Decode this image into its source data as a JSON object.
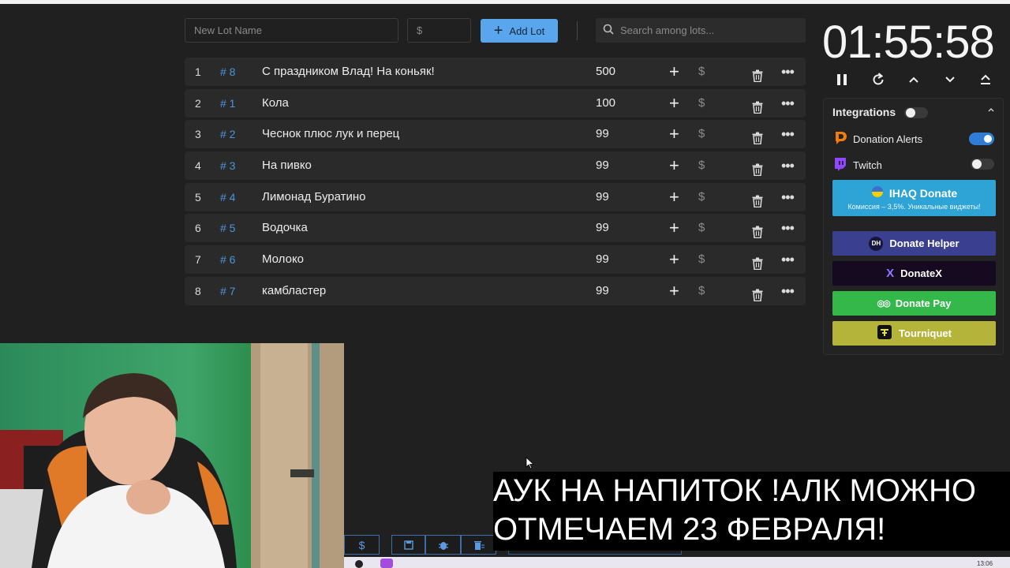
{
  "toolbar": {
    "lot_name_placeholder": "New Lot Name",
    "amount_placeholder": "$",
    "add_button_label": "Add Lot",
    "search_placeholder": "Search among lots..."
  },
  "lots": [
    {
      "index": "1",
      "id": "# 8",
      "name": "С праздником Влад! На коньяк!",
      "amount": "500"
    },
    {
      "index": "2",
      "id": "# 1",
      "name": "Кола",
      "amount": "100"
    },
    {
      "index": "3",
      "id": "# 2",
      "name": "Чеснок плюс лук и перец",
      "amount": "99"
    },
    {
      "index": "4",
      "id": "# 3",
      "name": "На пивко",
      "amount": "99"
    },
    {
      "index": "5",
      "id": "# 4",
      "name": "Лимонад Буратино",
      "amount": "99"
    },
    {
      "index": "6",
      "id": "# 5",
      "name": "Водочка",
      "amount": "99"
    },
    {
      "index": "7",
      "id": "# 6",
      "name": "Молоко",
      "amount": "99"
    },
    {
      "index": "8",
      "id": "# 7",
      "name": "камбластер",
      "amount": "99"
    }
  ],
  "lot_actions": {
    "plus": "+",
    "dollar": "$",
    "more": "•••"
  },
  "timer": {
    "value": "01:55:58"
  },
  "integrations": {
    "title": "Integrations",
    "enabled": false,
    "services": [
      {
        "name": "Donation Alerts",
        "enabled": true
      },
      {
        "name": "Twitch",
        "enabled": false
      }
    ],
    "promo": {
      "title": "IHAQ Donate",
      "subtitle": "Комиссия – 3,5%. Уникальные виджеты!"
    },
    "buttons": [
      {
        "label": "Donate Helper",
        "icon_text": "DH"
      },
      {
        "label": "DonateX",
        "icon_text": "X"
      },
      {
        "label": "Donate Pay",
        "icon_text": "◎◎"
      },
      {
        "label": "Tourniquet",
        "icon_text": ""
      }
    ],
    "colors": {
      "donation_alerts": "#f57d07",
      "twitch": "#9146ff",
      "ihaq": "#2ea3d6",
      "donate_helper": "#3b3f8f",
      "donatex": "#150a1f",
      "donate_pay": "#34b84a",
      "tourniquet": "#b5b43a"
    }
  },
  "bottom_bar": {
    "dollar_label": "$"
  },
  "overlay": {
    "line1": "АУК НА НАПИТОК !АЛК МОЖНО",
    "line2": "ОТМЕЧАЕМ 23 ФЕВРАЛЯ!"
  },
  "taskbar": {
    "clock": "13:06"
  }
}
